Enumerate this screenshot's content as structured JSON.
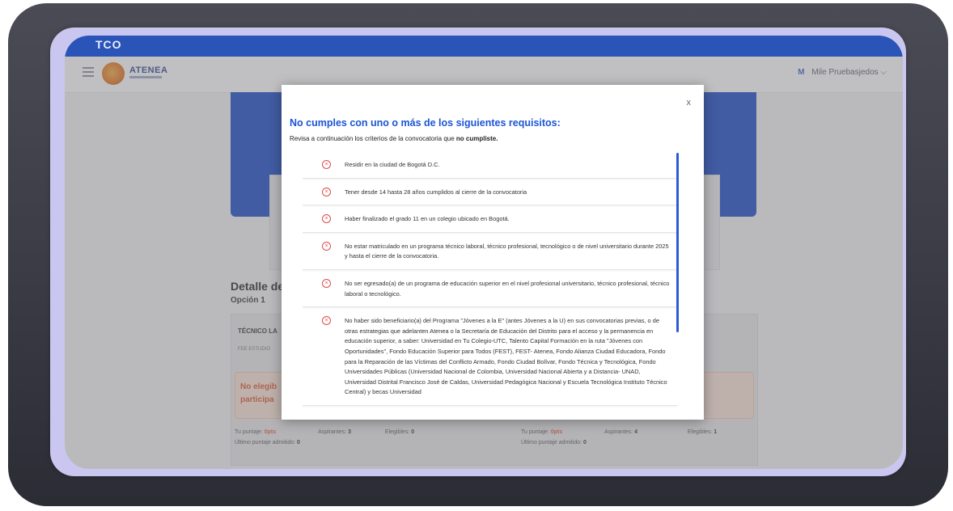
{
  "topbar": {
    "brand_fragment": "TCO"
  },
  "appbar": {
    "logo_text": "ATENEA",
    "user_initial": "M",
    "user_name": "Mile Pruebasjedos"
  },
  "background_page": {
    "detail_title": "Detalle de t",
    "option_label": "Opción 1",
    "program_heading": "TÉCNICO LA",
    "program_sub": "FEE ESTUDIO",
    "warning_line1": "No elegib",
    "warning_line2": "participa",
    "stats_left": {
      "score_label": "Tu puntaje:",
      "score_value": "0pts",
      "applicants_label": "Aspirantes:",
      "applicants_value": "3",
      "eligible_label": "Elegibles:",
      "eligible_value": "0",
      "last_score_label": "Último puntaje admitido:",
      "last_score_value": "0"
    },
    "stats_right": {
      "score_label": "Tu puntaje:",
      "score_value": "0pts",
      "applicants_label": "Aspirantes:",
      "applicants_value": "4",
      "eligible_label": "Elegibles:",
      "eligible_value": "1",
      "last_score_label": "Último puntaje admitido:",
      "last_score_value": "0"
    }
  },
  "modal": {
    "close_label": "x",
    "title": "No cumples con uno o más de los siguientes requisitos:",
    "subtitle_prefix": "Revisa a continuación los criterios de la convocatoria que",
    "subtitle_bold": "no cumpliste.",
    "requirements": [
      "Residir en la ciudad de Bogotá D.C.",
      "Tener desde 14 hasta 28 años cumplidos al cierre de la convocatoria",
      "Haber finalizado el grado 11 en un colegio ubicado en Bogotá.",
      "No estar matriculado en un programa técnico laboral, técnico profesional, tecnológico o de nivel universitario durante 2025 y hasta el cierre de la convocatoria.",
      "No ser egresado(a) de un programa de educación superior en el nivel profesional universitario, técnico profesional, técnico laboral o tecnológico.",
      "No haber sido beneficiario(a) del Programa \"Jóvenes a la E\" (antes Jóvenes a la U) en sus convocatorias previas, o de otras estrategias que adelanten Atenea o la Secretaría de Educación del Distrito para el acceso y la permanencia en educación superior, a saber: Universidad en Tu Colegio-UTC, Talento Capital Formación en la ruta \"Jóvenes con Oportunidades\", Fondo Educación Superior para Todos (FEST), FEST- Atenea, Fondo Alianza Ciudad Educadora, Fondo para la Reparación de las Víctimas del Conflicto Armado, Fondo Ciudad Bolívar, Fondo Técnica y Tecnológica, Fondo Universidades Públicas (Universidad Nacional de Colombia, Universidad Nacional Abierta y a Distancia- UNAD, Universidad Distrital Francisco José de Caldas, Universidad Pedagógica Nacional y Escuela Tecnológica Instituto Técnico Central) y becas Universidad"
    ]
  }
}
